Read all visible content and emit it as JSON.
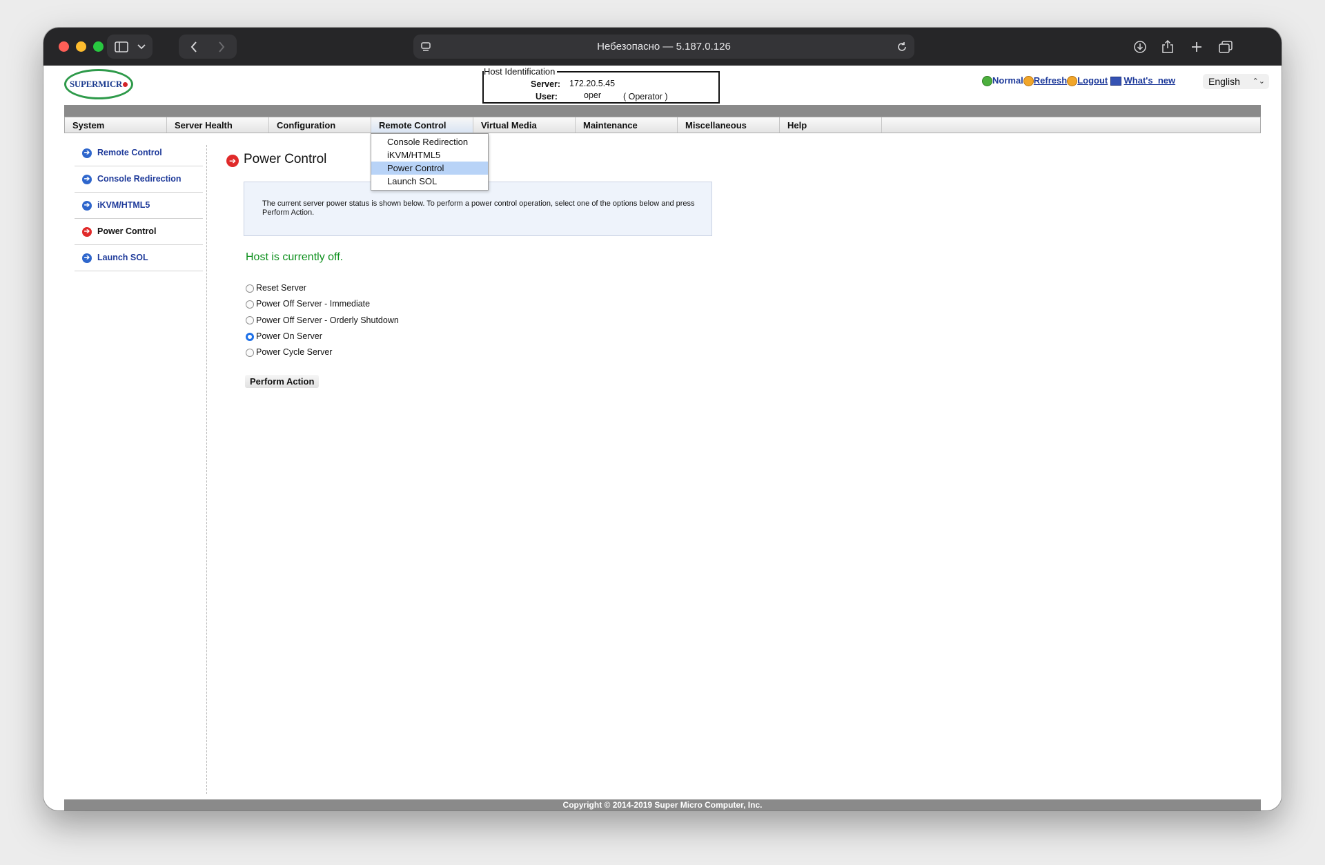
{
  "browser": {
    "url_text": "Небезопасно — 5.187.0.126",
    "icons": [
      "sidebar-icon",
      "chevron-down-icon",
      "back-icon",
      "forward-icon",
      "reader-icon",
      "reload-icon",
      "download-icon",
      "share-icon",
      "new-tab-icon",
      "tabs-icon"
    ]
  },
  "header": {
    "logo_text": "SUPERMICR",
    "host_ident": {
      "legend": "Host Identification",
      "server_label": "Server:",
      "server_value": "172.20.5.45",
      "user_label": "User:",
      "user_value": "oper",
      "role": "( Operator )"
    },
    "status_label": "Normal",
    "refresh_label": "Refresh",
    "logout_label": "Logout",
    "whats_new_label": "What's_new",
    "language": "English"
  },
  "nav": {
    "items": [
      "System",
      "Server Health",
      "Configuration",
      "Remote Control",
      "Virtual Media",
      "Maintenance",
      "Miscellaneous",
      "Help"
    ],
    "active": "Remote Control",
    "dropdown": [
      "Console Redirection",
      "iKVM/HTML5",
      "Power Control",
      "Launch SOL"
    ],
    "dropdown_highlight": "Power Control"
  },
  "sidebar": {
    "items": [
      "Remote Control",
      "Console Redirection",
      "iKVM/HTML5",
      "Power Control",
      "Launch SOL"
    ],
    "active": "Power Control"
  },
  "content": {
    "title": "Power Control",
    "info": "The current server power status is shown below. To perform a power control operation, select one of the options below and press Perform Action.",
    "status": "Host is currently off.",
    "options": [
      "Reset Server",
      "Power Off Server - Immediate",
      "Power Off Server - Orderly Shutdown",
      "Power On Server",
      "Power Cycle Server"
    ],
    "selected_option": "Power On Server",
    "perform_button": "Perform Action"
  },
  "footer": {
    "copyright": "Copyright © 2014-2019 Super Micro Computer, Inc."
  },
  "colors": {
    "status_green": "#0c8f1c",
    "link_blue": "#1e3a9a",
    "highlight": "#b8d3f7",
    "radio_selected": "#1f71e8"
  }
}
